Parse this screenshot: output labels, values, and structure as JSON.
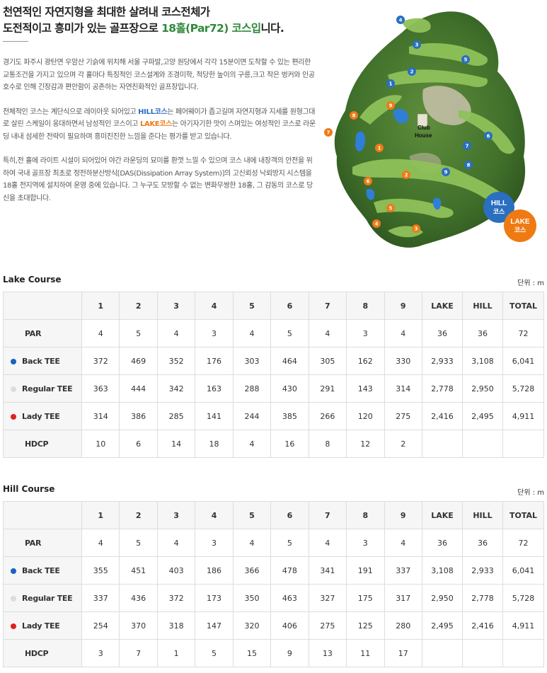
{
  "headline": {
    "line1": "천연적인 자연지형을 최대한 살려내 코스전체가",
    "line2_pre": "도전적이고 흥미가 있는 골프장으로 ",
    "line2_highlight": "18홀(Par72) 코스입",
    "line2_post": "니다."
  },
  "intro": {
    "p1": "경기도 파주시 광탄면 우암산 기슭에 위치해 서울 구파발,고양 원당에서 각각 15분이면 도착할 수 있는 편리한 교통조건을 가지고 있으며 각 홀마다 특징적인 코스설계와 조경미학, 적당한 높이의 구릉,크고 작은 벙커와 인공호수로 인해 긴장감과 편안함이 공존하는 자연친화적인 골프장입니다.",
    "p2_a": "전체적인 코스는 계단식으로 레이아웃 되어있고 ",
    "p2_hill": "HILL코스",
    "p2_b": "는 페어웨이가 좁고길며 자연지형과 지세를 원형그대로 살린 스케일이 웅대하면서 남성적인 코스이고 ",
    "p2_lake": "LAKE코스",
    "p2_c": "는 아기자기한 맛이 스며있는 여성적인 코스로 라운딩 내내 섬세한 전략이 필요하며 흥미진진한 느낌을 준다는 평가를 받고 있습니다.",
    "p3": "특히,전 홀에 라이트 시설이 되어있어 야간 라운딩의 묘미를 환껏 느낄 수 있으며 코스 내에 내장객의 안전을 위하여 국내 골프장 최초로 정전하분산방식[DAS(Dissipation Array System)]의 고신뢰성 낙뢰방지 시스템을 18홀 전지역에 설치하여 운영 중에 있습니다. 그 누구도 모방할 수 없는 변화무쌍한 18홀, 그 감동의 코스로 당신을 초대합니다."
  },
  "map": {
    "club_house_line1": "Club",
    "club_house_line2": "House",
    "hill_badge_line1": "HILL",
    "hill_badge_line2": "코스",
    "lake_badge_line1": "LAKE",
    "lake_badge_line2": "코스",
    "hill_color": "#2a6fc0",
    "lake_color": "#ef7a14",
    "hill_holes": [
      "4",
      "3",
      "5",
      "2",
      "1",
      "6",
      "7",
      "8",
      "9"
    ],
    "lake_holes": [
      "8",
      "9",
      "7",
      "1",
      "2",
      "6",
      "5",
      "4",
      "3"
    ]
  },
  "columns": [
    "1",
    "2",
    "3",
    "4",
    "5",
    "6",
    "7",
    "8",
    "9",
    "LAKE",
    "HILL",
    "TOTAL"
  ],
  "courses": [
    {
      "title": "Lake Course",
      "unit": "단위 : m",
      "rows": {
        "par": {
          "label": "PAR",
          "values": [
            "4",
            "5",
            "4",
            "3",
            "4",
            "5",
            "4",
            "3",
            "4",
            "36",
            "36",
            "72"
          ]
        },
        "back": {
          "label": "Back TEE",
          "dot": "#1565c0",
          "values": [
            "372",
            "469",
            "352",
            "176",
            "303",
            "464",
            "305",
            "162",
            "330",
            "2,933",
            "3,108",
            "6,041"
          ]
        },
        "regular": {
          "label": "Regular TEE",
          "dot": "#dcdcdc",
          "values": [
            "363",
            "444",
            "342",
            "163",
            "288",
            "430",
            "291",
            "143",
            "314",
            "2,778",
            "2,950",
            "5,728"
          ]
        },
        "lady": {
          "label": "Lady TEE",
          "dot": "#e02020",
          "values": [
            "314",
            "386",
            "285",
            "141",
            "244",
            "385",
            "266",
            "120",
            "275",
            "2,416",
            "2,495",
            "4,911"
          ]
        },
        "hdcp": {
          "label": "HDCP",
          "values": [
            "10",
            "6",
            "14",
            "18",
            "4",
            "16",
            "8",
            "12",
            "2",
            "",
            "",
            ""
          ]
        }
      }
    },
    {
      "title": "Hill Course",
      "unit": "단위 : m",
      "rows": {
        "par": {
          "label": "PAR",
          "values": [
            "4",
            "5",
            "4",
            "3",
            "4",
            "5",
            "4",
            "3",
            "4",
            "36",
            "36",
            "72"
          ]
        },
        "back": {
          "label": "Back TEE",
          "dot": "#1565c0",
          "values": [
            "355",
            "451",
            "403",
            "186",
            "366",
            "478",
            "341",
            "191",
            "337",
            "3,108",
            "2,933",
            "6,041"
          ]
        },
        "regular": {
          "label": "Regular TEE",
          "dot": "#dcdcdc",
          "values": [
            "337",
            "436",
            "372",
            "173",
            "350",
            "463",
            "327",
            "175",
            "317",
            "2,950",
            "2,778",
            "5,728"
          ]
        },
        "lady": {
          "label": "Lady TEE",
          "dot": "#e02020",
          "values": [
            "254",
            "370",
            "318",
            "147",
            "320",
            "406",
            "275",
            "125",
            "280",
            "2,495",
            "2,416",
            "4,911"
          ]
        },
        "hdcp": {
          "label": "HDCP",
          "values": [
            "3",
            "7",
            "1",
            "5",
            "15",
            "9",
            "13",
            "11",
            "17",
            "",
            "",
            ""
          ]
        }
      }
    }
  ]
}
